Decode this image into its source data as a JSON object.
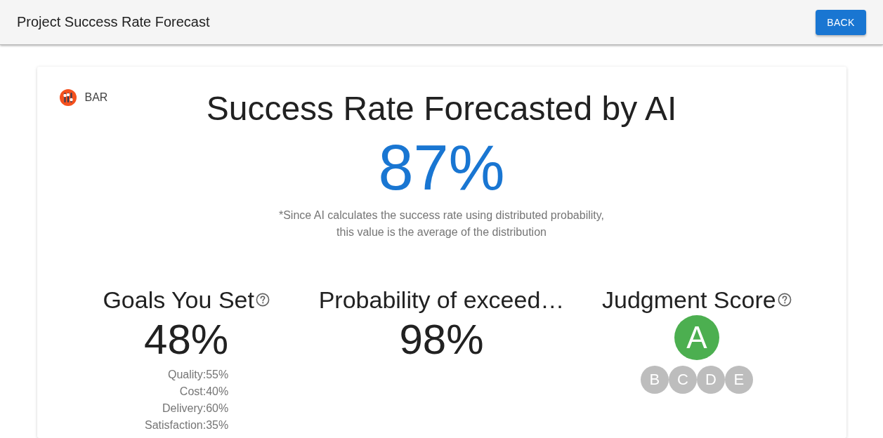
{
  "app_bar": {
    "title": "Project Success Rate Forecast",
    "back_button": "BACK"
  },
  "card": {
    "chart_type": "BAR",
    "heading": "Success Rate Forecasted by AI",
    "success_rate": "87%",
    "note": [
      "*Since AI calculates the success rate using distributed probability,",
      "this value is the average of the distribution"
    ],
    "metrics": [
      {
        "kind": "goals",
        "title": "Goals You Set",
        "help": true,
        "value": "48%",
        "breakdown": [
          "Quality:55%",
          "Cost:40%",
          "Delivery:60%",
          "Satisfaction:35%"
        ]
      },
      {
        "kind": "probability",
        "title": "Probability of exceed…",
        "help": false,
        "value": "98%"
      },
      {
        "kind": "grade",
        "title": "Judgment Score",
        "help": true,
        "grades": [
          {
            "label": "A",
            "selected": true
          },
          {
            "label": "B",
            "selected": false
          },
          {
            "label": "C",
            "selected": false
          },
          {
            "label": "D",
            "selected": false
          },
          {
            "label": "E",
            "selected": false
          }
        ]
      }
    ]
  }
}
